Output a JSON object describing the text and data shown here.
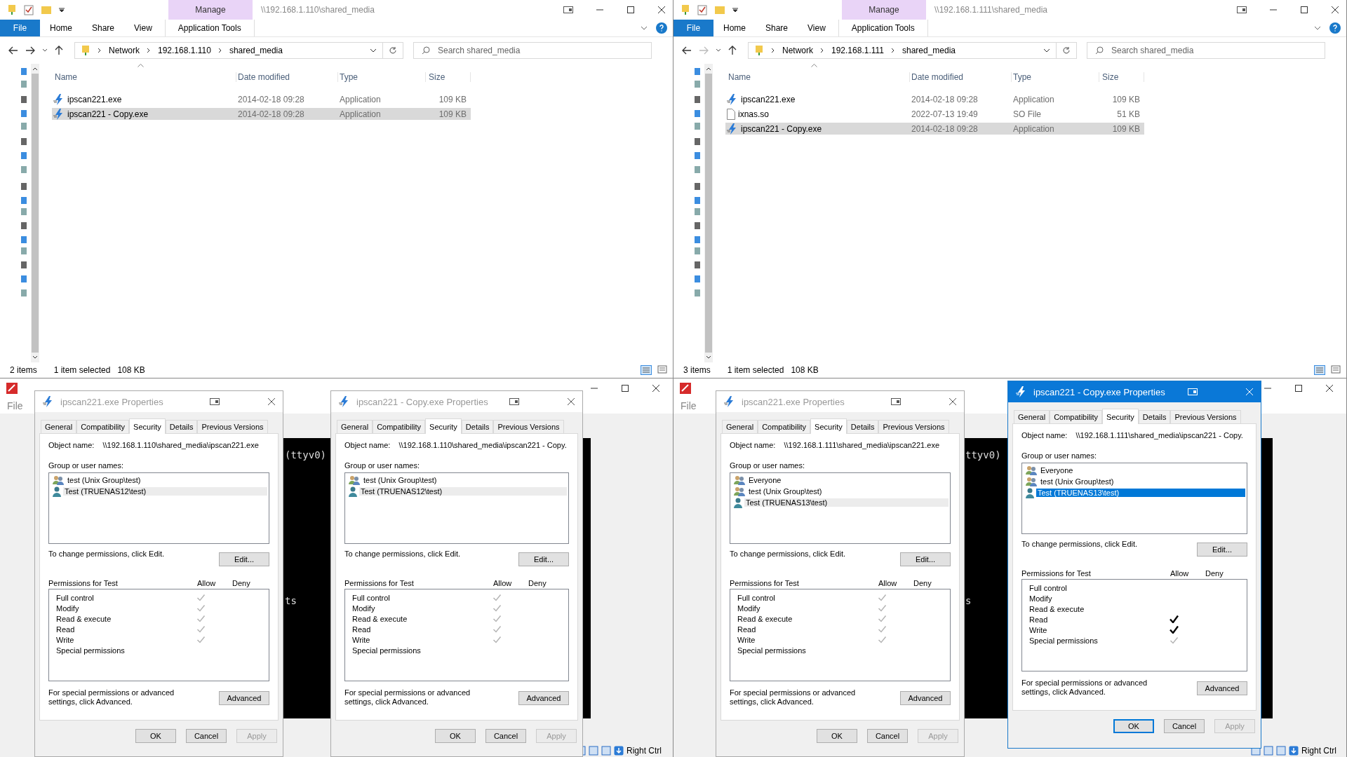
{
  "explorers": [
    {
      "title": "\\\\192.168.1.110\\shared_media",
      "context_header": "Manage",
      "ribbon_tabs": [
        {
          "label": "File",
          "kind": "file",
          "selected": false
        },
        {
          "label": "Home",
          "kind": "plain",
          "selected": false
        },
        {
          "label": "Share",
          "kind": "plain",
          "selected": false
        },
        {
          "label": "View",
          "kind": "plain",
          "selected": false
        },
        {
          "label": "Application Tools",
          "kind": "context",
          "selected": false
        }
      ],
      "forward_enabled": true,
      "breadcrumb": [
        "Network",
        "192.168.1.110",
        "shared_media"
      ],
      "search": {
        "placeholder": "Search shared_media"
      },
      "columns": [
        "Name",
        "Date modified",
        "Type",
        "Size"
      ],
      "files": [
        {
          "name": "ipscan221.exe",
          "date": "2014-02-18 09:28",
          "type": "Application",
          "size": "109 KB",
          "kind": "exe",
          "selected": false
        },
        {
          "name": "ipscan221 - Copy.exe",
          "date": "2014-02-18 09:28",
          "type": "Application",
          "size": "109 KB",
          "kind": "exe",
          "selected": true
        }
      ],
      "status": {
        "count": "2 items",
        "selection": "1 item selected",
        "selection_size": "108 KB"
      }
    },
    {
      "title": "\\\\192.168.1.111\\shared_media",
      "context_header": "Manage",
      "ribbon_tabs": [
        {
          "label": "File",
          "kind": "file",
          "selected": false
        },
        {
          "label": "Home",
          "kind": "plain",
          "selected": false
        },
        {
          "label": "Share",
          "kind": "plain",
          "selected": false
        },
        {
          "label": "View",
          "kind": "plain",
          "selected": false
        },
        {
          "label": "Application Tools",
          "kind": "context",
          "selected": false
        }
      ],
      "forward_enabled": false,
      "breadcrumb": [
        "Network",
        "192.168.1.111",
        "shared_media"
      ],
      "search": {
        "placeholder": "Search shared_media"
      },
      "columns": [
        "Name",
        "Date modified",
        "Type",
        "Size"
      ],
      "files": [
        {
          "name": "ipscan221.exe",
          "date": "2014-02-18 09:28",
          "type": "Application",
          "size": "109 KB",
          "kind": "exe",
          "selected": false
        },
        {
          "name": "ixnas.so",
          "date": "2022-07-13 19:49",
          "type": "SO File",
          "size": "51 KB",
          "kind": "file",
          "selected": false
        },
        {
          "name": "ipscan221 - Copy.exe",
          "date": "2014-02-18 09:28",
          "type": "Application",
          "size": "109 KB",
          "kind": "exe",
          "selected": true
        }
      ],
      "status": {
        "count": "3 items",
        "selection": "1 item selected",
        "selection_size": "108 KB"
      }
    }
  ],
  "vms": [
    {
      "menu": [
        "File"
      ],
      "console": [
        "(ttyv0)",
        "ts"
      ],
      "status": "Right Ctrl"
    },
    {
      "menu": [
        "File"
      ],
      "console": [
        "ttyv0)",
        "s"
      ],
      "status": "Right Ctrl"
    }
  ],
  "dialogs": [
    {
      "title": "ipscan221.exe Properties",
      "active": false,
      "tabs": [
        {
          "label": "General",
          "selected": false
        },
        {
          "label": "Compatibility",
          "selected": false
        },
        {
          "label": "Security",
          "selected": true
        },
        {
          "label": "Details",
          "selected": false
        },
        {
          "label": "Previous Versions",
          "selected": false
        }
      ],
      "object_label": "Object name:",
      "object_name": "\\\\192.168.1.110\\shared_media\\ipscan221.exe",
      "group_label": "Group or user names:",
      "users": [
        {
          "name": "test (Unix Group\\test)",
          "kind": "group",
          "selected": false
        },
        {
          "name": "Test (TRUENAS12\\test)",
          "kind": "user",
          "selected": true
        }
      ],
      "change_text": "To change permissions, click Edit.",
      "edit_button": "Edit...",
      "perm_label": "Permissions for Test",
      "allow_label": "Allow",
      "deny_label": "Deny",
      "permissions": [
        {
          "name": "Full control",
          "allow": true,
          "inherited": true
        },
        {
          "name": "Modify",
          "allow": true,
          "inherited": true
        },
        {
          "name": "Read & execute",
          "allow": true,
          "inherited": true
        },
        {
          "name": "Read",
          "allow": true,
          "inherited": true
        },
        {
          "name": "Write",
          "allow": true,
          "inherited": true
        },
        {
          "name": "Special permissions",
          "allow": false
        }
      ],
      "advanced_text": "For special permissions or advanced settings, click Advanced.",
      "advanced_button": "Advanced",
      "buttons": [
        {
          "label": "OK",
          "disabled": false
        },
        {
          "label": "Cancel",
          "disabled": false
        },
        {
          "label": "Apply",
          "disabled": true
        }
      ]
    },
    {
      "title": "ipscan221 - Copy.exe Properties",
      "active": false,
      "tabs": [
        {
          "label": "General",
          "selected": false
        },
        {
          "label": "Compatibility",
          "selected": false
        },
        {
          "label": "Security",
          "selected": true
        },
        {
          "label": "Details",
          "selected": false
        },
        {
          "label": "Previous Versions",
          "selected": false
        }
      ],
      "object_label": "Object name:",
      "object_name": "\\\\192.168.1.110\\shared_media\\ipscan221 - Copy.",
      "group_label": "Group or user names:",
      "users": [
        {
          "name": "test (Unix Group\\test)",
          "kind": "group",
          "selected": false
        },
        {
          "name": "Test (TRUENAS12\\test)",
          "kind": "user",
          "selected": true
        }
      ],
      "change_text": "To change permissions, click Edit.",
      "edit_button": "Edit...",
      "perm_label": "Permissions for Test",
      "allow_label": "Allow",
      "deny_label": "Deny",
      "permissions": [
        {
          "name": "Full control",
          "allow": true,
          "inherited": true
        },
        {
          "name": "Modify",
          "allow": true,
          "inherited": true
        },
        {
          "name": "Read & execute",
          "allow": true,
          "inherited": true
        },
        {
          "name": "Read",
          "allow": true,
          "inherited": true
        },
        {
          "name": "Write",
          "allow": true,
          "inherited": true
        },
        {
          "name": "Special permissions",
          "allow": false
        }
      ],
      "advanced_text": "For special permissions or advanced settings, click Advanced.",
      "advanced_button": "Advanced",
      "buttons": [
        {
          "label": "OK",
          "disabled": false
        },
        {
          "label": "Cancel",
          "disabled": false
        },
        {
          "label": "Apply",
          "disabled": true
        }
      ]
    },
    {
      "title": "ipscan221.exe Properties",
      "active": false,
      "tabs": [
        {
          "label": "General",
          "selected": false
        },
        {
          "label": "Compatibility",
          "selected": false
        },
        {
          "label": "Security",
          "selected": true
        },
        {
          "label": "Details",
          "selected": false
        },
        {
          "label": "Previous Versions",
          "selected": false
        }
      ],
      "object_label": "Object name:",
      "object_name": "\\\\192.168.1.111\\shared_media\\ipscan221.exe",
      "group_label": "Group or user names:",
      "users": [
        {
          "name": "Everyone",
          "kind": "group",
          "selected": false
        },
        {
          "name": "test (Unix Group\\test)",
          "kind": "group",
          "selected": false
        },
        {
          "name": "Test (TRUENAS13\\test)",
          "kind": "user",
          "selected": true
        }
      ],
      "change_text": "To change permissions, click Edit.",
      "edit_button": "Edit...",
      "perm_label": "Permissions for Test",
      "allow_label": "Allow",
      "deny_label": "Deny",
      "permissions": [
        {
          "name": "Full control",
          "allow": true,
          "inherited": true
        },
        {
          "name": "Modify",
          "allow": true,
          "inherited": true
        },
        {
          "name": "Read & execute",
          "allow": true,
          "inherited": true
        },
        {
          "name": "Read",
          "allow": true,
          "inherited": true
        },
        {
          "name": "Write",
          "allow": true,
          "inherited": true
        },
        {
          "name": "Special permissions",
          "allow": false
        }
      ],
      "advanced_text": "For special permissions or advanced settings, click Advanced.",
      "advanced_button": "Advanced",
      "buttons": [
        {
          "label": "OK",
          "disabled": false
        },
        {
          "label": "Cancel",
          "disabled": false
        },
        {
          "label": "Apply",
          "disabled": true
        }
      ]
    },
    {
      "title": "ipscan221 - Copy.exe Properties",
      "active": true,
      "tabs": [
        {
          "label": "General",
          "selected": false
        },
        {
          "label": "Compatibility",
          "selected": false
        },
        {
          "label": "Security",
          "selected": true
        },
        {
          "label": "Details",
          "selected": false
        },
        {
          "label": "Previous Versions",
          "selected": false
        }
      ],
      "object_label": "Object name:",
      "object_name": "\\\\192.168.1.111\\shared_media\\ipscan221 - Copy.",
      "group_label": "Group or user names:",
      "users": [
        {
          "name": "Everyone",
          "kind": "group",
          "selected": false
        },
        {
          "name": "test (Unix Group\\test)",
          "kind": "group",
          "selected": false
        },
        {
          "name": "Test (TRUENAS13\\test)",
          "kind": "user",
          "selected": true
        }
      ],
      "change_text": "To change permissions, click Edit.",
      "edit_button": "Edit...",
      "perm_label": "Permissions for Test",
      "allow_label": "Allow",
      "deny_label": "Deny",
      "permissions": [
        {
          "name": "Full control",
          "allow": false
        },
        {
          "name": "Modify",
          "allow": false
        },
        {
          "name": "Read & execute",
          "allow": false
        },
        {
          "name": "Read",
          "allow": true,
          "inherited": false
        },
        {
          "name": "Write",
          "allow": true,
          "inherited": false
        },
        {
          "name": "Special permissions",
          "allow": true,
          "inherited": true
        }
      ],
      "advanced_text": "For special permissions or advanced settings, click Advanced.",
      "advanced_button": "Advanced",
      "buttons": [
        {
          "label": "OK",
          "disabled": false
        },
        {
          "label": "Cancel",
          "disabled": false
        },
        {
          "label": "Apply",
          "disabled": true
        }
      ]
    }
  ]
}
